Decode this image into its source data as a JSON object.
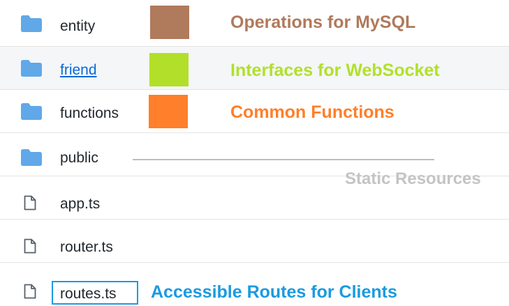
{
  "colors": {
    "folder": "#61a8e8",
    "file_outline": "#57606a",
    "mysql": "#b07a5c",
    "websocket": "#b2e02a",
    "common": "#ff7f2a",
    "static": "#c4c4c4",
    "routes": "#1a9be0"
  },
  "entries": [
    {
      "name": "entity",
      "type": "folder",
      "icon": "folder-icon"
    },
    {
      "name": "friend",
      "type": "folder",
      "icon": "folder-icon",
      "link": true
    },
    {
      "name": "functions",
      "type": "folder",
      "icon": "folder-icon"
    },
    {
      "name": "public",
      "type": "folder",
      "icon": "folder-icon"
    },
    {
      "name": "app.ts",
      "type": "file",
      "icon": "file-icon"
    },
    {
      "name": "router.ts",
      "type": "file",
      "icon": "file-icon"
    },
    {
      "name": "routes.ts",
      "type": "file",
      "icon": "file-icon"
    }
  ],
  "annotations": {
    "mysql": "Operations for MySQL",
    "websocket": "Interfaces for WebSocket",
    "common": "Common Functions",
    "static": "Static Resources",
    "routes": "Accessible Routes for Clients"
  }
}
